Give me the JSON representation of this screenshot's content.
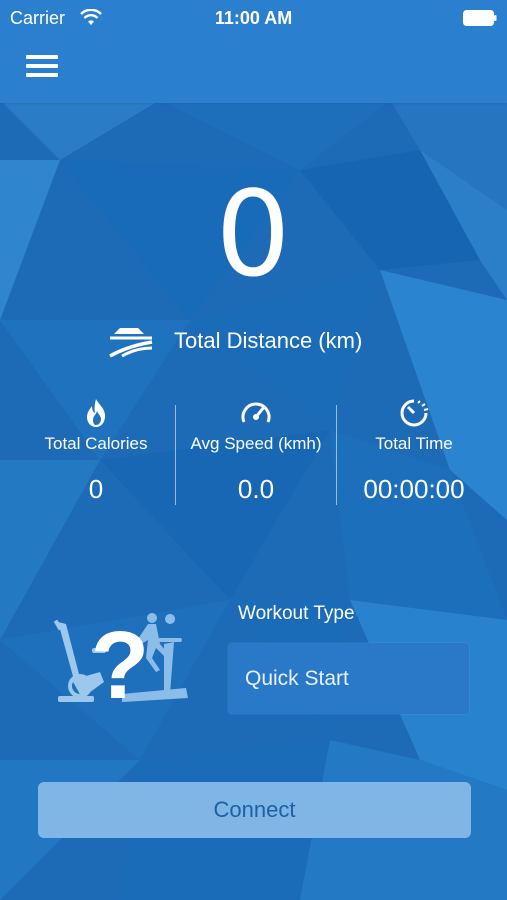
{
  "status_bar": {
    "carrier": "Carrier",
    "time": "11:00 AM"
  },
  "nav": {
    "menu_icon": "hamburger-menu-icon"
  },
  "dashboard": {
    "total_distance_value": "0",
    "total_distance_label": "Total Distance (km)",
    "stats": [
      {
        "label": "Total Calories",
        "value": "0",
        "icon": "flame-icon"
      },
      {
        "label": "Avg Speed (kmh)",
        "value": "0.0",
        "icon": "speedometer-icon"
      },
      {
        "label": "Total Time",
        "value": "00:00:00",
        "icon": "stopwatch-icon"
      }
    ]
  },
  "workout": {
    "title": "Workout Type",
    "selected": "Quick Start",
    "icon": "workout-equipment-question-icon"
  },
  "actions": {
    "connect_label": "Connect"
  },
  "colors": {
    "background": "#1d6bb7",
    "bar": "#2a7fcf",
    "select_bg": "#2a78c8",
    "connect_bg": "#7fb6e6",
    "connect_text": "#1f5fa6"
  }
}
